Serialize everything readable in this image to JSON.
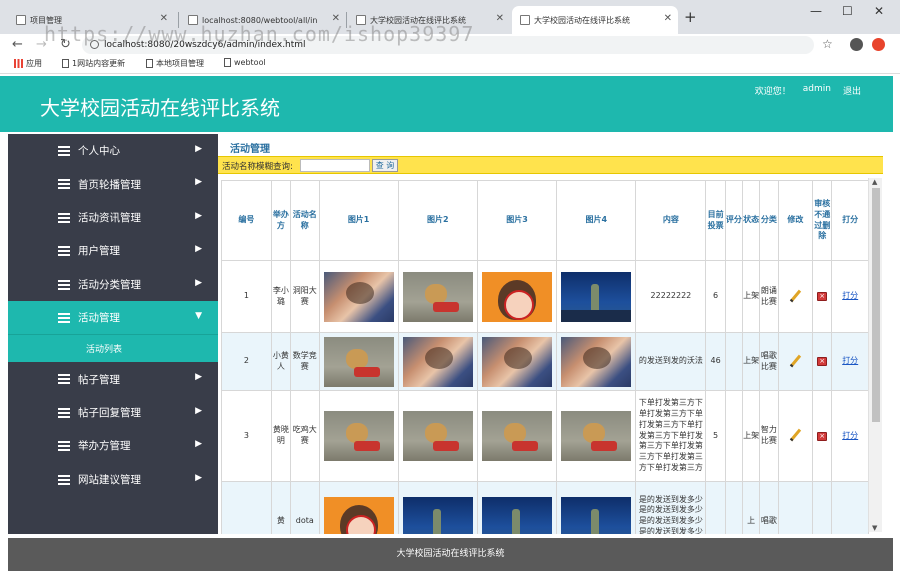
{
  "browser": {
    "tabs": [
      {
        "label": "项目管理",
        "active": false
      },
      {
        "label": "localhost:8080/webtool/all/in",
        "active": false
      },
      {
        "label": "大学校园活动在线评比系统",
        "active": false
      },
      {
        "label": "大学校园活动在线评比系统",
        "active": true
      }
    ],
    "url": "localhost:8080/20wszdcy6/admin/index.html",
    "watermark": "https://www.huzhan.com/ishop39397",
    "bookmarks": [
      "应用",
      "1网站内容更新",
      "本地项目管理",
      "webtool"
    ]
  },
  "header": {
    "title": "大学校园活动在线评比系统",
    "welcome": "欢迎您！",
    "username": "admin",
    "logout": "退出"
  },
  "sidebar": {
    "items": [
      {
        "label": "个人中心"
      },
      {
        "label": "首页轮播管理"
      },
      {
        "label": "活动资讯管理"
      },
      {
        "label": "用户管理"
      },
      {
        "label": "活动分类管理"
      },
      {
        "label": "活动管理",
        "active": true
      },
      {
        "label": "帖子管理"
      },
      {
        "label": "帖子回复管理"
      },
      {
        "label": "举办方管理"
      },
      {
        "label": "网站建议管理"
      }
    ],
    "subitem": "活动列表"
  },
  "main": {
    "page_title": "活动管理",
    "search_label": "活动名称模糊查询:",
    "search_value": "",
    "search_button": "查 询",
    "columns": [
      "编号",
      "举办方",
      "活动名称",
      "图片1",
      "图片2",
      "图片3",
      "图片4",
      "内容",
      "目前投票",
      "评分",
      "状态",
      "分类",
      "修改",
      "审核不通过删除",
      "打分"
    ],
    "rows": [
      {
        "id": "1",
        "org": "李小璐",
        "name": "洞阳大赛",
        "pics": [
          "hug",
          "bear",
          "girl",
          "night"
        ],
        "content": "22222222",
        "votes": "6",
        "score": "",
        "status": "上架",
        "category": "朗诵比赛",
        "grade": "打分"
      },
      {
        "id": "2",
        "org": "小黄人",
        "name": "数学竞赛",
        "pics": [
          "bear",
          "hug",
          "hug",
          "hug"
        ],
        "content": "的发送到发的沃法",
        "votes": "46",
        "score": "",
        "status": "上架",
        "category": "唱歌比赛",
        "grade": "打分"
      },
      {
        "id": "3",
        "org": "黄晓明",
        "name": "吃鸡大赛",
        "pics": [
          "bear",
          "bear",
          "bear",
          "bear"
        ],
        "content": "下单打发第三方下单打发第三方下单打发第三方下单打发第三方下单打发第三方下单打发第三方下单打发第三方下单打发第三方",
        "votes": "5",
        "score": "",
        "status": "上架",
        "category": "智力比赛",
        "grade": "打分"
      },
      {
        "id": "",
        "org": "黄",
        "name": "dota",
        "pics": [
          "girl",
          "night",
          "night",
          "night"
        ],
        "content": "是的发送到发多少是的发送到发多少是的发送到发多少是的发送到发多少是的发送到",
        "votes": "",
        "score": "",
        "status": "上",
        "category": "唱歌",
        "grade": ""
      }
    ]
  },
  "footer": {
    "text": "大学校园活动在线评比系统"
  }
}
